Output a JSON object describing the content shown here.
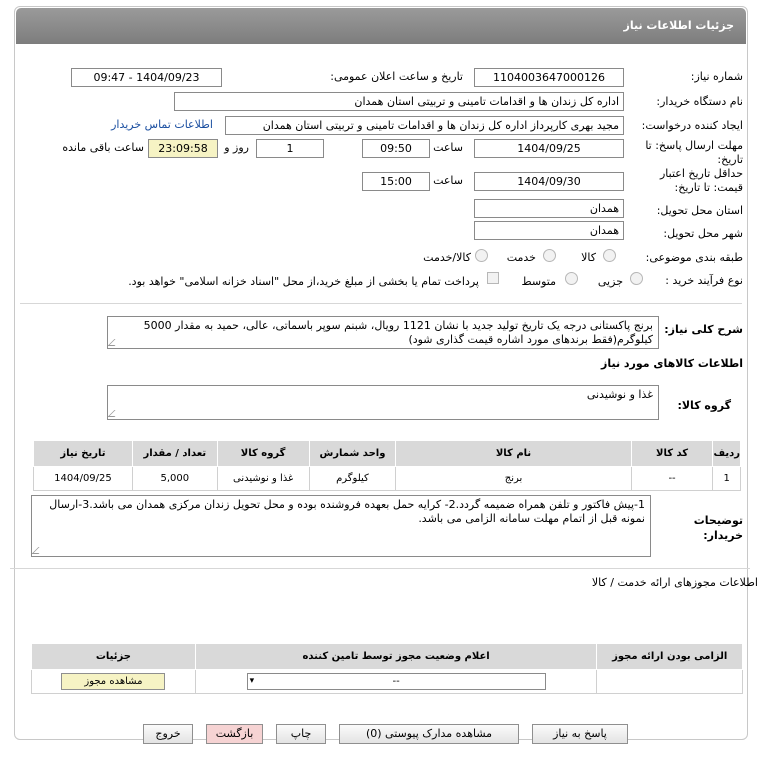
{
  "header": {
    "title": "جزئیات اطلاعات نیاز"
  },
  "fields": {
    "need_number_label": "شماره نیاز:",
    "need_number": "1104003647000126",
    "announce_label": "تاریخ و ساعت اعلان عمومی:",
    "announce_value": "1404/09/23 - 09:47",
    "buyer_org_label": "نام دستگاه خریدار:",
    "buyer_org": "اداره کل زندان ها و اقدامات تامینی و تربیتی استان همدان",
    "requester_label": "ایجاد کننده درخواست:",
    "requester": "مجید بهری کارپرداز اداره کل زندان ها و اقدامات تامینی و تربیتی استان همدان",
    "contact_link": "اطلاعات تماس خریدار",
    "deadline_label_1": "مهلت ارسال پاسخ: تا",
    "deadline_label_2": "تاریخ:",
    "deadline_date": "1404/09/25",
    "time_label": "ساعت",
    "deadline_time": "09:50",
    "days_value": "1",
    "days_label": "روز و",
    "remaining_time": "23:09:58",
    "remaining_label": "ساعت باقی مانده",
    "price_validity_label_1": "حداقل تاریخ اعتبار",
    "price_validity_label_2": "قیمت: تا تاریخ:",
    "price_validity_date": "1404/09/30",
    "price_validity_time": "15:00",
    "province_label": "استان محل تحویل:",
    "province": "همدان",
    "city_label": "شهر محل تحویل:",
    "city": "همدان",
    "category_label": "طبقه بندی موضوعی:",
    "category_options": [
      "کالا",
      "خدمت",
      "کالا/خدمت"
    ],
    "process_label": "نوع فرآیند خرید :",
    "process_options": [
      "جزیی",
      "متوسط"
    ],
    "payment_note": "پرداخت تمام یا بخشی از مبلغ خرید،از محل \"اسناد خزانه اسلامی\" خواهد بود."
  },
  "description": {
    "label": "شرح کلی نیاز:",
    "text": "برنج پاکستانی درجه یک تاریخ تولید جدید با نشان 1121 رویال، شبنم سوپر باسماتی، عالی، حمید به مقدار 5000 کیلوگرم(فقط برندهای مورد اشاره قیمت گذاری شود)"
  },
  "goods": {
    "section_title": "اطلاعات کالاهای مورد نیاز",
    "group_label": "گروه کالا:",
    "group_value": "غذا و نوشیدنی",
    "columns": [
      "ردیف",
      "کد کالا",
      "نام کالا",
      "واحد شمارش",
      "گروه کالا",
      "تعداد / مقدار",
      "تاریخ نیاز"
    ],
    "rows": [
      [
        "1",
        "--",
        "برنج",
        "کیلوگرم",
        "غذا و نوشیدنی",
        "5,000",
        "1404/09/25"
      ]
    ]
  },
  "buyer_notes": {
    "label_1": "توضیحات",
    "label_2": "خریدار:",
    "text": "1-پیش فاکتور و تلفن همراه ضمیمه گردد.2- کرایه حمل بعهده فروشنده بوده و محل تحویل زندان مرکزی همدان می باشد.3-ارسال نمونه قبل از اتمام مهلت سامانه الزامی می باشد."
  },
  "permits": {
    "section_title": "اطلاعات مجوزهای ارائه خدمت / کالا",
    "columns": [
      "الزامی بودن ارائه مجوز",
      "اعلام وضعیت مجوز توسط تامین کننده",
      "جزئیات"
    ],
    "select_value": "--",
    "view_button": "مشاهده مجوز"
  },
  "buttons": {
    "reply": "پاسخ به نیاز",
    "docs": "مشاهده مدارک پیوستی (0)",
    "print": "چاپ",
    "back": "بازگشت",
    "exit": "خروج"
  },
  "colors": {
    "header": "#8a8a8a",
    "link": "#1a4ea0",
    "highlight": "#f6f3c4",
    "pink_button": "#f6d3d3"
  }
}
